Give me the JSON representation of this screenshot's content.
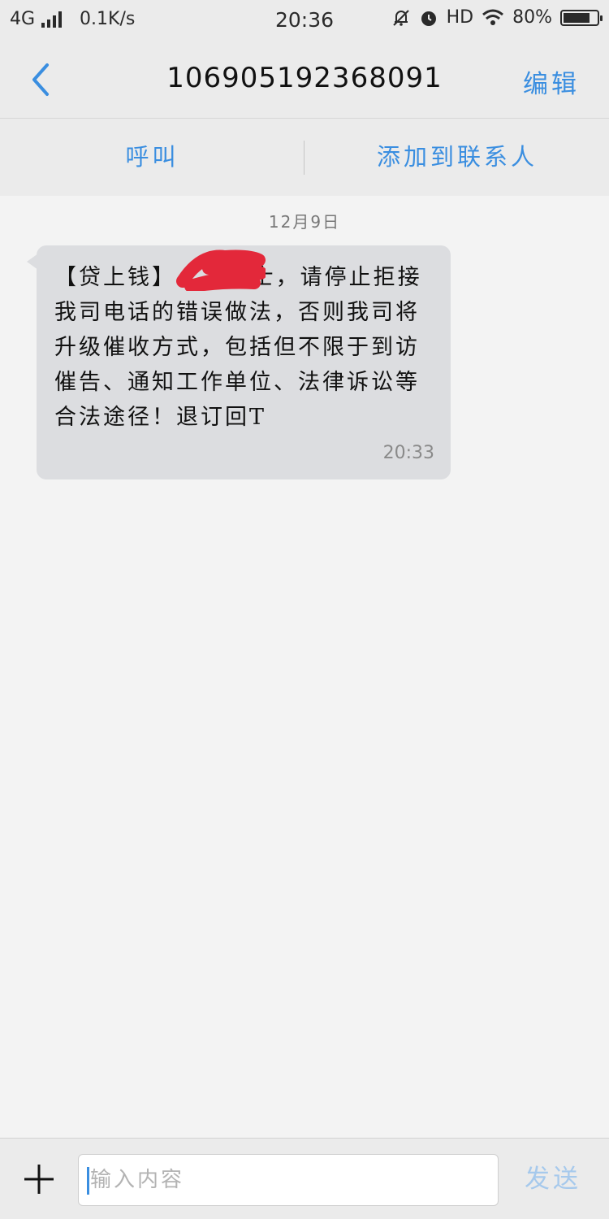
{
  "status_bar": {
    "network": "4G",
    "speed": "0.1K/s",
    "time": "20:36",
    "hd": "HD",
    "battery": "80%",
    "battery_level": 0.8,
    "icons": [
      "signal-icon",
      "mute-icon",
      "alarm-icon",
      "wifi-icon",
      "battery-icon"
    ]
  },
  "header": {
    "title": "106905192368091",
    "edit_label": "编辑"
  },
  "actions": {
    "call_label": "呼叫",
    "add_contact_label": "添加到联系人"
  },
  "conversation": {
    "date": "12月9日",
    "messages": [
      {
        "text": "【贷上钱】        士，请停止拒接我司电话的错误做法，否则我司将升级催收方式，包括但不限于到访催告、通知工作单位、法律诉讼等合法途径！退订回T",
        "time": "20:33"
      }
    ]
  },
  "input": {
    "placeholder": "输入内容",
    "value": "",
    "send_label": "发送"
  },
  "colors": {
    "accent": "#3a8ee0",
    "bubble": "#dcdde0",
    "background": "#f3f3f3",
    "redaction": "#e3283a"
  }
}
